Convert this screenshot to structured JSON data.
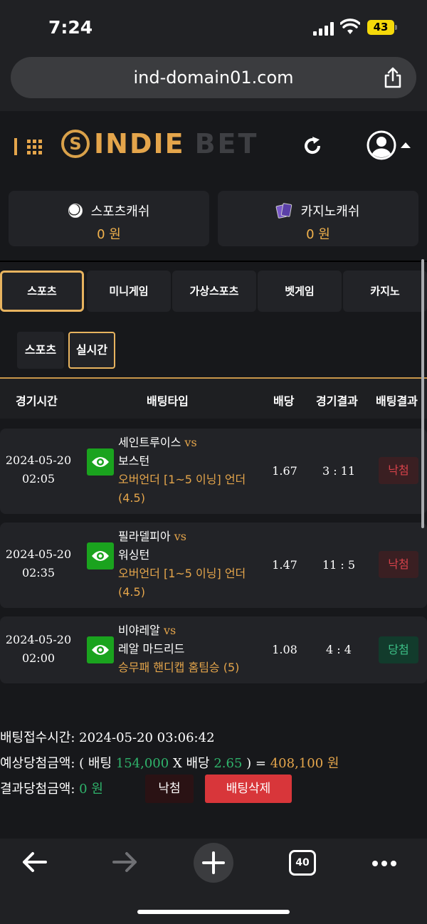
{
  "status_bar": {
    "time": "7:24",
    "battery": "43"
  },
  "browser": {
    "url": "ind-domain01.com",
    "tab_count": "40"
  },
  "header": {
    "logo_indie": "INDIE",
    "logo_bet": "BET"
  },
  "wallets": [
    {
      "label": "스포츠캐쉬",
      "value": "0 원",
      "icon": "soccer-ball-icon"
    },
    {
      "label": "카지노캐쉬",
      "value": "0 원",
      "icon": "playing-cards-icon"
    }
  ],
  "tabs": [
    "스포츠",
    "미니게임",
    "가상스포츠",
    "벳게임",
    "카지노"
  ],
  "subtabs": [
    "스포츠",
    "실시간"
  ],
  "table_headers": [
    "경기시간",
    "배팅타입",
    "배당",
    "경기결과",
    "배팅결과"
  ],
  "rows": [
    {
      "date": "2024-05-20",
      "time": "02:05",
      "home": "세인트루이스",
      "vs": "vs",
      "away": "보스턴",
      "bet_line1": "오버언더 [1~5 이닝] 언더",
      "bet_line2": "(4.5)",
      "odds": "1.67",
      "score": "3 : 11",
      "result": "낙첨"
    },
    {
      "date": "2024-05-20",
      "time": "02:35",
      "home": "필라델피아",
      "vs": "vs",
      "away": "워싱턴",
      "bet_line1": "오버언더 [1~5 이닝] 언더",
      "bet_line2": "(4.5)",
      "odds": "1.47",
      "score": "11 : 5",
      "result": "낙첨"
    },
    {
      "date": "2024-05-20",
      "time": "02:00",
      "home": "비야레알",
      "vs": "vs",
      "away": "레알 마드리드",
      "bet_line1": "승무패 핸디캡 홈팀승 (5)",
      "bet_line2": "",
      "odds": "1.08",
      "score": "4 : 4",
      "result": "당첨"
    }
  ],
  "summary": {
    "received_label": "배팅접수시간:",
    "received_value": "2024-05-20 03:06:42",
    "expected_label": "예상당첨금액:",
    "expected_open": "( 배팅",
    "stake": "154,000",
    "times": "X 배당",
    "total_odds": "2.65",
    "expected_close": ") =",
    "payout": "408,100 원",
    "result_label": "결과당첨금액:",
    "result_value": "0 원",
    "status_button": "낙첨",
    "delete_button": "배팅삭제"
  }
}
